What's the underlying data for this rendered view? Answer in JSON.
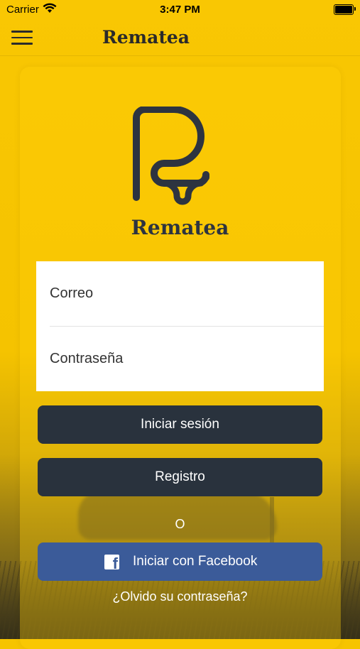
{
  "status_bar": {
    "carrier": "Carrier",
    "time": "3:47 PM"
  },
  "nav": {
    "title": "Rematea"
  },
  "logo": {
    "text": "Rematea"
  },
  "form": {
    "email_placeholder": "Correo",
    "password_placeholder": "Contraseña"
  },
  "buttons": {
    "login": "Iniciar sesión",
    "register": "Registro",
    "or": "O",
    "facebook": "Iniciar con Facebook"
  },
  "forgot": "¿Olvido su contraseña?",
  "colors": {
    "brand_yellow": "#f6c400",
    "dark": "#29323d",
    "facebook": "#3b5b99"
  }
}
